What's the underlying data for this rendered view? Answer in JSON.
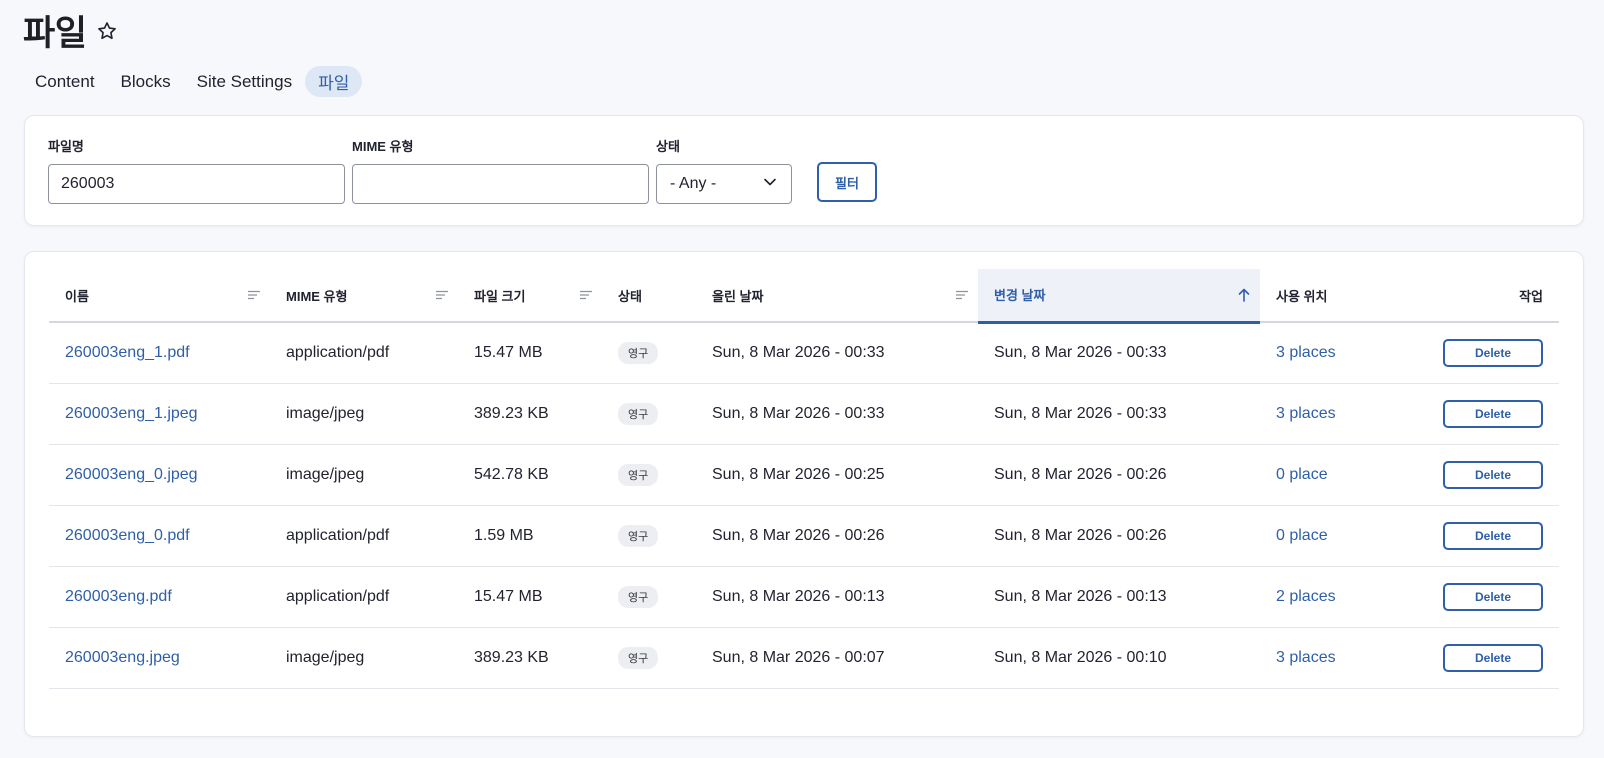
{
  "page": {
    "title": "파일"
  },
  "tabs": [
    {
      "label": "Content"
    },
    {
      "label": "Blocks"
    },
    {
      "label": "Site Settings"
    },
    {
      "label": "파일",
      "active": true
    }
  ],
  "filters": {
    "filename": {
      "label": "파일명",
      "value": "260003"
    },
    "mime": {
      "label": "MIME 유형",
      "value": ""
    },
    "status": {
      "label": "상태",
      "selected": "- Any -"
    },
    "submit_label": "필터"
  },
  "table": {
    "columns": [
      {
        "key": "name",
        "label": "이름",
        "sortable": true
      },
      {
        "key": "mime",
        "label": "MIME 유형",
        "sortable": true
      },
      {
        "key": "size",
        "label": "파일 크기",
        "sortable": true
      },
      {
        "key": "status",
        "label": "상태",
        "sortable": false
      },
      {
        "key": "uploaded",
        "label": "올린 날짜",
        "sortable": true
      },
      {
        "key": "changed",
        "label": "변경 날짜",
        "sortable": true,
        "sorted": "asc"
      },
      {
        "key": "usage",
        "label": "사용 위치",
        "sortable": false
      },
      {
        "key": "actions",
        "label": "작업",
        "sortable": false
      }
    ],
    "rows": [
      {
        "name": "260003eng_1.pdf",
        "mime": "application/pdf",
        "size": "15.47 MB",
        "status": "영구",
        "uploaded": "Sun, 8 Mar 2026 - 00:33",
        "changed": "Sun, 8 Mar 2026 - 00:33",
        "usage": "3 places",
        "action": "Delete"
      },
      {
        "name": "260003eng_1.jpeg",
        "mime": "image/jpeg",
        "size": "389.23 KB",
        "status": "영구",
        "uploaded": "Sun, 8 Mar 2026 - 00:33",
        "changed": "Sun, 8 Mar 2026 - 00:33",
        "usage": "3 places",
        "action": "Delete"
      },
      {
        "name": "260003eng_0.jpeg",
        "mime": "image/jpeg",
        "size": "542.78 KB",
        "status": "영구",
        "uploaded": "Sun, 8 Mar 2026 - 00:25",
        "changed": "Sun, 8 Mar 2026 - 00:26",
        "usage": "0 place",
        "action": "Delete"
      },
      {
        "name": "260003eng_0.pdf",
        "mime": "application/pdf",
        "size": "1.59 MB",
        "status": "영구",
        "uploaded": "Sun, 8 Mar 2026 - 00:26",
        "changed": "Sun, 8 Mar 2026 - 00:26",
        "usage": "0 place",
        "action": "Delete"
      },
      {
        "name": "260003eng.pdf",
        "mime": "application/pdf",
        "size": "15.47 MB",
        "status": "영구",
        "uploaded": "Sun, 8 Mar 2026 - 00:13",
        "changed": "Sun, 8 Mar 2026 - 00:13",
        "usage": "2 places",
        "action": "Delete"
      },
      {
        "name": "260003eng.jpeg",
        "mime": "image/jpeg",
        "size": "389.23 KB",
        "status": "영구",
        "uploaded": "Sun, 8 Mar 2026 - 00:07",
        "changed": "Sun, 8 Mar 2026 - 00:10",
        "usage": "3 places",
        "action": "Delete"
      }
    ]
  },
  "colors": {
    "accent": "#2f5fa8",
    "active_tab_bg": "#dde7f6",
    "sorted_header_bg": "#eef2f8"
  },
  "icons": {
    "favorite": "star-outline-icon",
    "sort": "sort-lines-icon",
    "sorted": "arrow-up-icon",
    "dropdown": "chevron-down-icon"
  }
}
